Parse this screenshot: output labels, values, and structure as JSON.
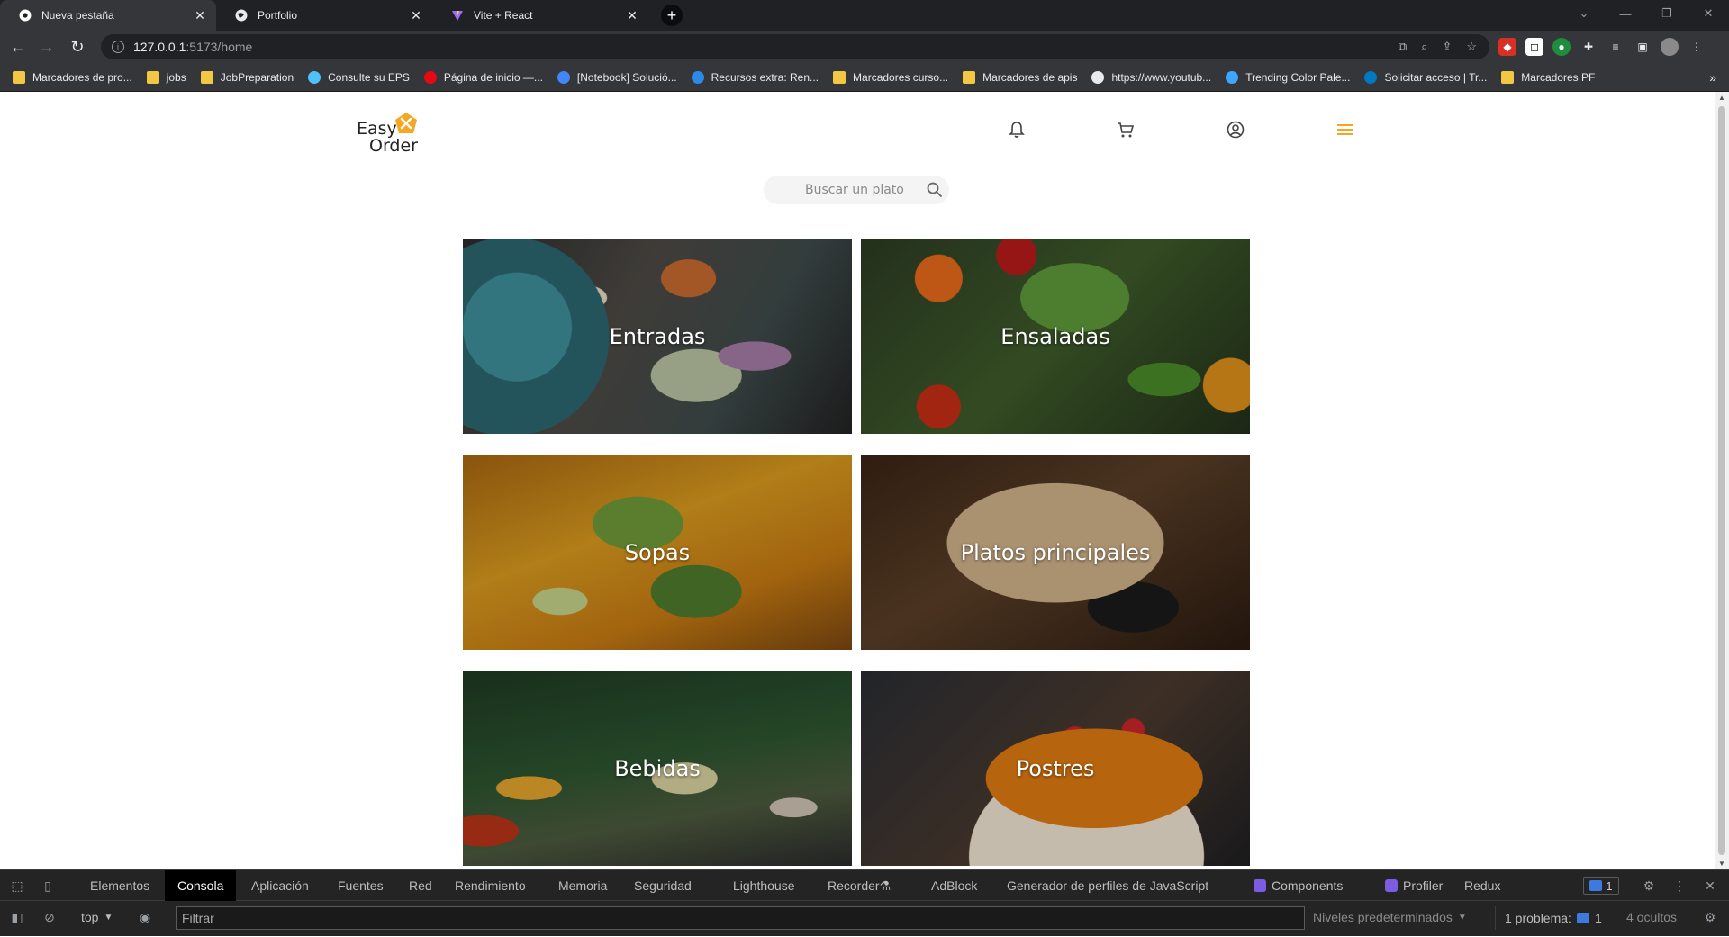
{
  "browser": {
    "tabs": [
      {
        "title": "Nueva pestaña",
        "active": true
      },
      {
        "title": "Portfolio",
        "active": false
      },
      {
        "title": "Vite + React",
        "active": false
      }
    ],
    "url_host": "127.0.0.1",
    "url_path": ":5173/home",
    "bookmarks": [
      {
        "label": "Marcadores de pro...",
        "icon": "folder-icon"
      },
      {
        "label": "jobs",
        "icon": "folder-icon"
      },
      {
        "label": "JobPreparation",
        "icon": "folder-icon"
      },
      {
        "label": "Consulte su EPS",
        "icon": "cross-icon"
      },
      {
        "label": "Página de inicio —...",
        "icon": "netflix-icon"
      },
      {
        "label": "[Notebook] Solució...",
        "icon": "a-logo-icon"
      },
      {
        "label": "Recursos extra: Ren...",
        "icon": "circle-icon"
      },
      {
        "label": "Marcadores curso...",
        "icon": "folder-icon"
      },
      {
        "label": "Marcadores de apis",
        "icon": "folder-icon"
      },
      {
        "label": "https://www.youtub...",
        "icon": "globe-icon"
      },
      {
        "label": "Trending Color Pale...",
        "icon": "palette-icon"
      },
      {
        "label": "Solicitar acceso | Tr...",
        "icon": "trello-icon"
      },
      {
        "label": "Marcadores PF",
        "icon": "folder-icon"
      }
    ]
  },
  "app": {
    "logo_line1": "Easy",
    "logo_line2": "Order",
    "accent_color": "#f5a623",
    "search_placeholder": "Buscar un plato",
    "categories": [
      {
        "label": "Entradas"
      },
      {
        "label": "Ensaladas"
      },
      {
        "label": "Sopas"
      },
      {
        "label": "Platos principales"
      },
      {
        "label": "Bebidas"
      },
      {
        "label": "Postres"
      }
    ]
  },
  "devtools": {
    "tabs": [
      "Elementos",
      "Consola",
      "Aplicación",
      "Fuentes",
      "Red",
      "Rendimiento",
      "Memoria",
      "Seguridad",
      "Lighthouse",
      "Recorder",
      "AdBlock",
      "Generador de perfiles de JavaScript",
      "Components",
      "Profiler",
      "Redux"
    ],
    "active_tab": "Consola",
    "issues_count": "1",
    "context": "top",
    "filter_placeholder": "Filtrar",
    "levels": "Niveles predeterminados",
    "problems_label": "1 problema:",
    "problems_count": "1",
    "hidden": "4 ocultos"
  }
}
